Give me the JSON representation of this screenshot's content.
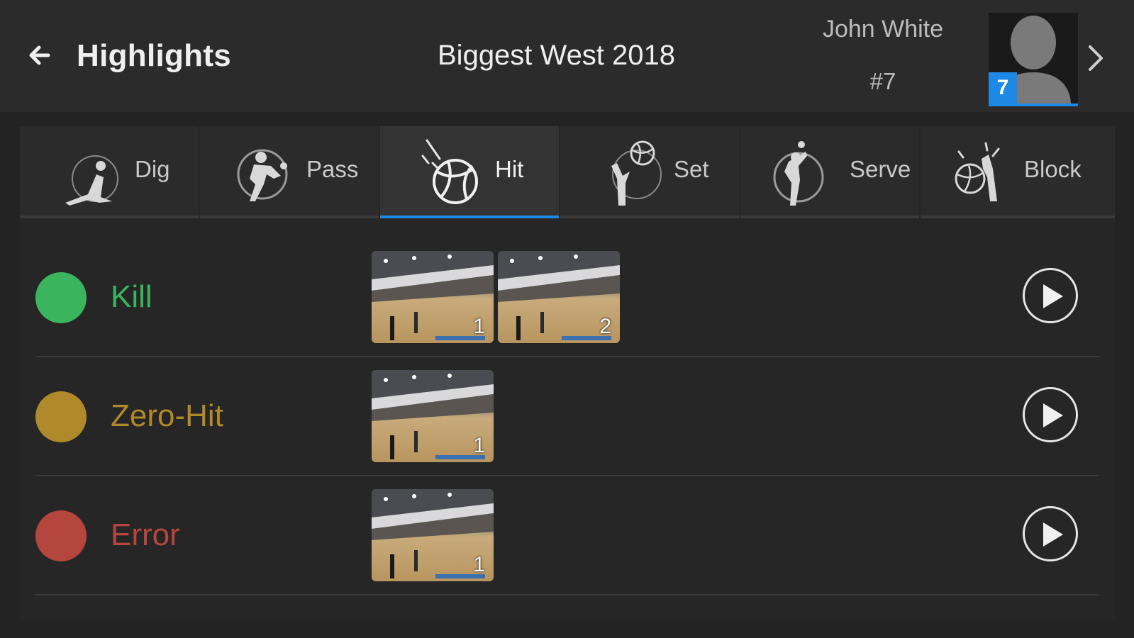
{
  "header": {
    "back_icon": "arrow-left-icon",
    "title": "Highlights",
    "event": "Biggest West 2018",
    "player": {
      "name": "John White",
      "number": "#7",
      "badge": "7"
    },
    "next_icon": "chevron-right-icon"
  },
  "tabs": [
    {
      "label": "Dig",
      "icon": "dig-icon",
      "active": false
    },
    {
      "label": "Pass",
      "icon": "pass-icon",
      "active": false
    },
    {
      "label": "Hit",
      "icon": "hit-icon",
      "active": true
    },
    {
      "label": "Set",
      "icon": "set-icon",
      "active": false
    },
    {
      "label": "Serve",
      "icon": "serve-icon",
      "active": false
    },
    {
      "label": "Block",
      "icon": "block-icon",
      "active": false
    }
  ],
  "rows": [
    {
      "label": "Kill",
      "color": "#3bb55d",
      "clips": [
        "1",
        "2"
      ]
    },
    {
      "label": "Zero-Hit",
      "color": "#b08a2a",
      "clips": [
        "1"
      ]
    },
    {
      "label": "Error",
      "color": "#b5463e",
      "clips": [
        "1"
      ]
    }
  ],
  "colors": {
    "accent": "#1e88e5",
    "background": "#232323",
    "topbar": "#2b2b2b"
  }
}
